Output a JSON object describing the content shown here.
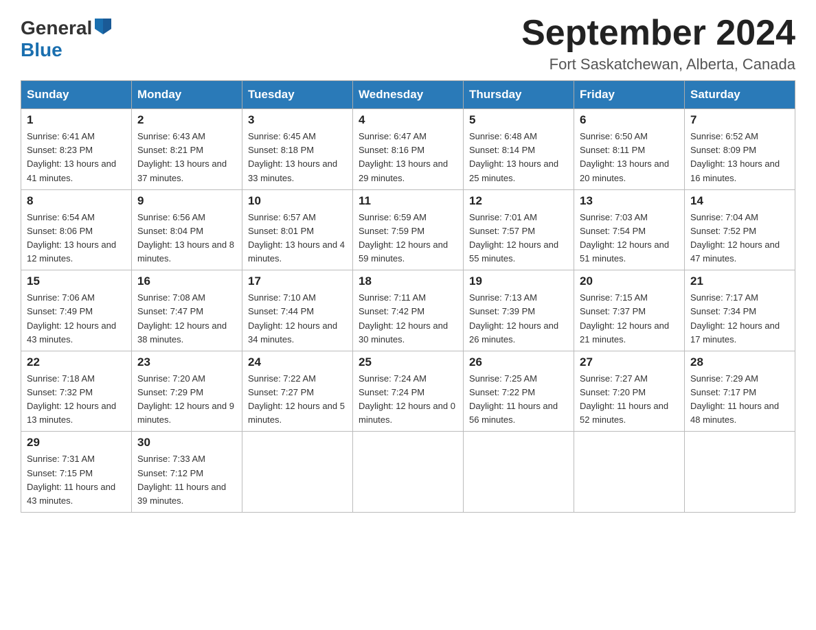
{
  "header": {
    "logo_general": "General",
    "logo_blue": "Blue",
    "title": "September 2024",
    "location": "Fort Saskatchewan, Alberta, Canada"
  },
  "days_of_week": [
    "Sunday",
    "Monday",
    "Tuesday",
    "Wednesday",
    "Thursday",
    "Friday",
    "Saturday"
  ],
  "weeks": [
    [
      {
        "day": "1",
        "sunrise": "6:41 AM",
        "sunset": "8:23 PM",
        "daylight": "13 hours and 41 minutes."
      },
      {
        "day": "2",
        "sunrise": "6:43 AM",
        "sunset": "8:21 PM",
        "daylight": "13 hours and 37 minutes."
      },
      {
        "day": "3",
        "sunrise": "6:45 AM",
        "sunset": "8:18 PM",
        "daylight": "13 hours and 33 minutes."
      },
      {
        "day": "4",
        "sunrise": "6:47 AM",
        "sunset": "8:16 PM",
        "daylight": "13 hours and 29 minutes."
      },
      {
        "day": "5",
        "sunrise": "6:48 AM",
        "sunset": "8:14 PM",
        "daylight": "13 hours and 25 minutes."
      },
      {
        "day": "6",
        "sunrise": "6:50 AM",
        "sunset": "8:11 PM",
        "daylight": "13 hours and 20 minutes."
      },
      {
        "day": "7",
        "sunrise": "6:52 AM",
        "sunset": "8:09 PM",
        "daylight": "13 hours and 16 minutes."
      }
    ],
    [
      {
        "day": "8",
        "sunrise": "6:54 AM",
        "sunset": "8:06 PM",
        "daylight": "13 hours and 12 minutes."
      },
      {
        "day": "9",
        "sunrise": "6:56 AM",
        "sunset": "8:04 PM",
        "daylight": "13 hours and 8 minutes."
      },
      {
        "day": "10",
        "sunrise": "6:57 AM",
        "sunset": "8:01 PM",
        "daylight": "13 hours and 4 minutes."
      },
      {
        "day": "11",
        "sunrise": "6:59 AM",
        "sunset": "7:59 PM",
        "daylight": "12 hours and 59 minutes."
      },
      {
        "day": "12",
        "sunrise": "7:01 AM",
        "sunset": "7:57 PM",
        "daylight": "12 hours and 55 minutes."
      },
      {
        "day": "13",
        "sunrise": "7:03 AM",
        "sunset": "7:54 PM",
        "daylight": "12 hours and 51 minutes."
      },
      {
        "day": "14",
        "sunrise": "7:04 AM",
        "sunset": "7:52 PM",
        "daylight": "12 hours and 47 minutes."
      }
    ],
    [
      {
        "day": "15",
        "sunrise": "7:06 AM",
        "sunset": "7:49 PM",
        "daylight": "12 hours and 43 minutes."
      },
      {
        "day": "16",
        "sunrise": "7:08 AM",
        "sunset": "7:47 PM",
        "daylight": "12 hours and 38 minutes."
      },
      {
        "day": "17",
        "sunrise": "7:10 AM",
        "sunset": "7:44 PM",
        "daylight": "12 hours and 34 minutes."
      },
      {
        "day": "18",
        "sunrise": "7:11 AM",
        "sunset": "7:42 PM",
        "daylight": "12 hours and 30 minutes."
      },
      {
        "day": "19",
        "sunrise": "7:13 AM",
        "sunset": "7:39 PM",
        "daylight": "12 hours and 26 minutes."
      },
      {
        "day": "20",
        "sunrise": "7:15 AM",
        "sunset": "7:37 PM",
        "daylight": "12 hours and 21 minutes."
      },
      {
        "day": "21",
        "sunrise": "7:17 AM",
        "sunset": "7:34 PM",
        "daylight": "12 hours and 17 minutes."
      }
    ],
    [
      {
        "day": "22",
        "sunrise": "7:18 AM",
        "sunset": "7:32 PM",
        "daylight": "12 hours and 13 minutes."
      },
      {
        "day": "23",
        "sunrise": "7:20 AM",
        "sunset": "7:29 PM",
        "daylight": "12 hours and 9 minutes."
      },
      {
        "day": "24",
        "sunrise": "7:22 AM",
        "sunset": "7:27 PM",
        "daylight": "12 hours and 5 minutes."
      },
      {
        "day": "25",
        "sunrise": "7:24 AM",
        "sunset": "7:24 PM",
        "daylight": "12 hours and 0 minutes."
      },
      {
        "day": "26",
        "sunrise": "7:25 AM",
        "sunset": "7:22 PM",
        "daylight": "11 hours and 56 minutes."
      },
      {
        "day": "27",
        "sunrise": "7:27 AM",
        "sunset": "7:20 PM",
        "daylight": "11 hours and 52 minutes."
      },
      {
        "day": "28",
        "sunrise": "7:29 AM",
        "sunset": "7:17 PM",
        "daylight": "11 hours and 48 minutes."
      }
    ],
    [
      {
        "day": "29",
        "sunrise": "7:31 AM",
        "sunset": "7:15 PM",
        "daylight": "11 hours and 43 minutes."
      },
      {
        "day": "30",
        "sunrise": "7:33 AM",
        "sunset": "7:12 PM",
        "daylight": "11 hours and 39 minutes."
      },
      null,
      null,
      null,
      null,
      null
    ]
  ],
  "labels": {
    "sunrise": "Sunrise:",
    "sunset": "Sunset:",
    "daylight": "Daylight:"
  }
}
